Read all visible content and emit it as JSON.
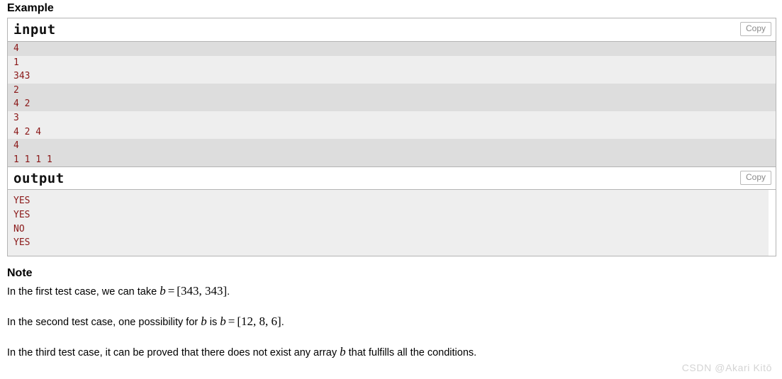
{
  "example": {
    "heading": "Example",
    "input": {
      "title": "input",
      "copy_label": "Copy",
      "groups": [
        {
          "lines": [
            "4"
          ]
        },
        {
          "lines": [
            "1",
            "343"
          ]
        },
        {
          "lines": [
            "2",
            "4 2"
          ]
        },
        {
          "lines": [
            "3",
            "4 2 4"
          ]
        },
        {
          "lines": [
            "4",
            "1 1 1 1"
          ]
        }
      ]
    },
    "output": {
      "title": "output",
      "copy_label": "Copy",
      "lines": [
        "YES",
        "YES",
        "NO",
        "YES"
      ]
    }
  },
  "note": {
    "heading": "Note",
    "paragraphs": [
      {
        "prefix": "In the first test case, we can take ",
        "math": {
          "var": "b",
          "op": "=",
          "value": "[343, 343]"
        },
        "suffix": "."
      },
      {
        "prefix": "In the second test case, one possibility for ",
        "mid_var": "b",
        "mid_text": " is ",
        "math": {
          "var": "b",
          "op": "=",
          "value": "[12, 8, 6]"
        },
        "suffix": "."
      },
      {
        "prefix": "In the third test case, it can be proved that there does not exist any array ",
        "inline_var": "b",
        "suffix": " that fulfills all the conditions."
      }
    ]
  },
  "watermark": {
    "text": "CSDN @Akari  Kitō"
  },
  "colors": {
    "code_text": "#8a1818",
    "stripe_dark": "#dddddd",
    "stripe_light": "#eeeeee",
    "border": "#b4b4b4",
    "copy_text": "#8a8a8a",
    "watermark": "#d4d4d4"
  }
}
